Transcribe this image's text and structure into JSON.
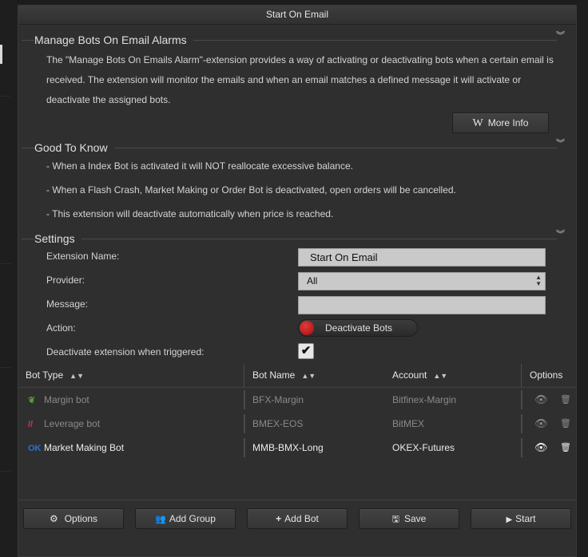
{
  "modal": {
    "title": "Start On Email"
  },
  "sections": {
    "manage": {
      "title": "Manage Bots On Email Alarms",
      "description": "The \"Manage Bots On Emails Alarm\"-extension provides a way of activating or deactivating bots when a certain email is received. The extension will monitor the emails and when an email matches a defined message it will activate or deactivate the assigned bots.",
      "more_info_label": "More Info",
      "more_info_icon": "wikipedia-icon"
    },
    "good_to_know": {
      "title": "Good To Know",
      "items": [
        "- When a Index Bot is activated it will NOT reallocate excessive balance.",
        "- When a Flash Crash, Market Making or Order Bot is deactivated, open orders will be cancelled.",
        "- This extension will deactivate automatically when price is reached."
      ]
    },
    "settings": {
      "title": "Settings",
      "extension_name_label": "Extension Name:",
      "extension_name_value": "Start On Email",
      "provider_label": "Provider:",
      "provider_value": "All",
      "message_label": "Message:",
      "message_value": "",
      "action_label": "Action:",
      "action_value": "Deactivate Bots",
      "deactivate_label": "Deactivate extension when triggered:",
      "deactivate_checked": true
    }
  },
  "table": {
    "headers": {
      "bot_type": "Bot Type",
      "bot_name": "Bot Name",
      "account": "Account",
      "options": "Options"
    },
    "rows": [
      {
        "icon": "leaf-icon",
        "icon_glyph": "❦",
        "icon_color": "#5a9a3a",
        "bot_type": "Margin bot",
        "bot_name": "BFX-Margin",
        "account": "Bitfinex-Margin",
        "active": false
      },
      {
        "icon": "bitmex-icon",
        "icon_glyph": "//",
        "icon_color": "#c43a57",
        "bot_type": "Leverage bot",
        "bot_name": "BMEX-EOS",
        "account": "BitMEX",
        "active": false
      },
      {
        "icon": "okex-icon",
        "icon_glyph": "OK",
        "icon_color": "#2b6fd8",
        "bot_type": "Market Making Bot",
        "bot_name": "MMB-BMX-Long",
        "account": "OKEX-Futures",
        "active": true
      }
    ]
  },
  "footer": {
    "options": "Options",
    "add_group": "Add Group",
    "add_bot": "Add Bot",
    "save": "Save",
    "start": "Start"
  },
  "colors": {
    "panel": "#2f2f2f",
    "toggle_knob": "#d12a2a"
  }
}
